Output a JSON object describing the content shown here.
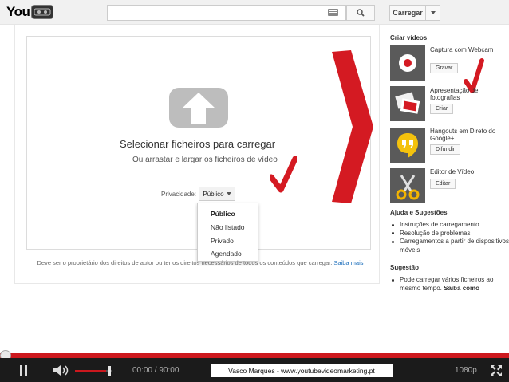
{
  "header": {
    "logo_text": "You",
    "search_placeholder": "",
    "upload_button": "Carregar"
  },
  "upload": {
    "title": "Selecionar ficheiros para carregar",
    "subtitle": "Ou arrastar e largar os ficheiros de vídeo",
    "privacy_label": "Privacidade:",
    "privacy_value": "Público",
    "privacy_options": [
      "Público",
      "Não listado",
      "Privado",
      "Agendado"
    ],
    "rights_note": "Deve ser o proprietário dos direitos de autor ou ter os direitos necessários de todos os conteúdos que carregar.",
    "rights_link": "Saiba mais"
  },
  "sidebar": {
    "create_heading": "Criar vídeos",
    "tiles": [
      {
        "label": "Captura com Webcam",
        "button": "Gravar",
        "icon": "webcam-record-icon"
      },
      {
        "label": "Apresentação de fotografias",
        "button": "Criar",
        "icon": "photos-icon"
      },
      {
        "label": "Hangouts em Direto do Google+",
        "button": "Difundir",
        "icon": "hangouts-icon"
      },
      {
        "label": "Editor de Vídeo",
        "button": "Editar",
        "icon": "scissors-icon"
      }
    ],
    "help_heading": "Ajuda e Sugestões",
    "help_items": [
      "Instruções de carregamento",
      "Resolução de problemas",
      "Carregamentos a partir de dispositivos móveis"
    ],
    "tip_heading": "Sugestão",
    "tip_text": "Pode carregar vários ficheiros ao mesmo tempo.",
    "tip_link": "Saiba como"
  },
  "player": {
    "time": "00:00 / 90:00",
    "credit": "Vasco Marques - www.youtubevideomarketing.pt",
    "quality": "1080p",
    "volume_fraction": 0.85,
    "progress_fraction": 0.0
  },
  "colors": {
    "accent_red": "#cc181e",
    "link_blue": "#1a6dbb"
  }
}
